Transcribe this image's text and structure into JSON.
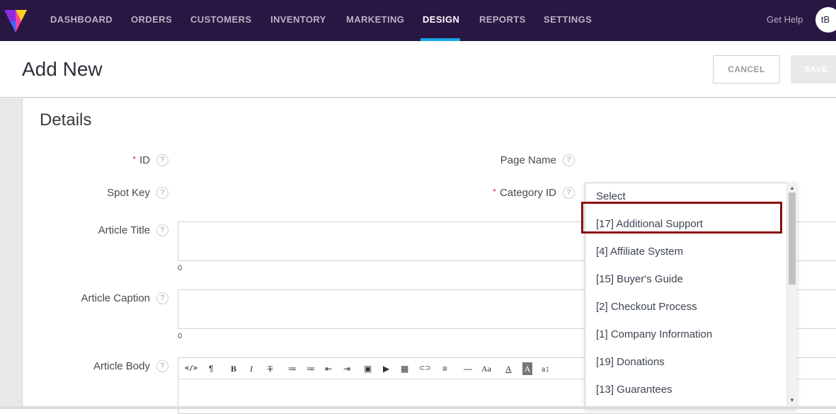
{
  "nav": {
    "items": [
      {
        "label": "DASHBOARD"
      },
      {
        "label": "ORDERS"
      },
      {
        "label": "CUSTOMERS"
      },
      {
        "label": "INVENTORY"
      },
      {
        "label": "MARKETING"
      },
      {
        "label": "DESIGN"
      },
      {
        "label": "REPORTS"
      },
      {
        "label": "SETTINGS"
      }
    ],
    "active": "DESIGN",
    "get_help": "Get Help",
    "avatar_initials": "tB",
    "logo_icon": "volusion-logo-icon",
    "colors": {
      "nav_bg": "#2a1642",
      "active_underline": "#1aa7e8"
    }
  },
  "header": {
    "title": "Add New",
    "cancel_label": "CANCEL",
    "save_label": "SAVE"
  },
  "details": {
    "section_title": "Details",
    "required_mark": "*",
    "help_glyph": "?",
    "fields": {
      "id": "ID",
      "page_name": "Page Name",
      "spot_key": "Spot Key",
      "category_id": "Category ID",
      "article_title": "Article Title",
      "article_caption": "Article Caption",
      "article_body": "Article Body"
    },
    "title_count": "0",
    "caption_count": "0"
  },
  "editor_toolbar": [
    "</>",
    "¶",
    "B",
    "I",
    "T",
    "≔",
    "≔",
    "⇤",
    "⇥",
    "▣",
    "▶",
    "▦",
    "⊂⊃",
    "≡",
    "—",
    "Aa",
    "A",
    "A",
    "a↕"
  ],
  "category_dropdown": {
    "options": [
      "Select",
      "[17] Additional Support",
      "[4] Affiliate System",
      "[15] Buyer's Guide",
      "[2] Checkout Process",
      "[1] Company Information",
      "[19] Donations",
      "[13] Guarantees"
    ],
    "highlighted": "[17] Additional Support"
  }
}
